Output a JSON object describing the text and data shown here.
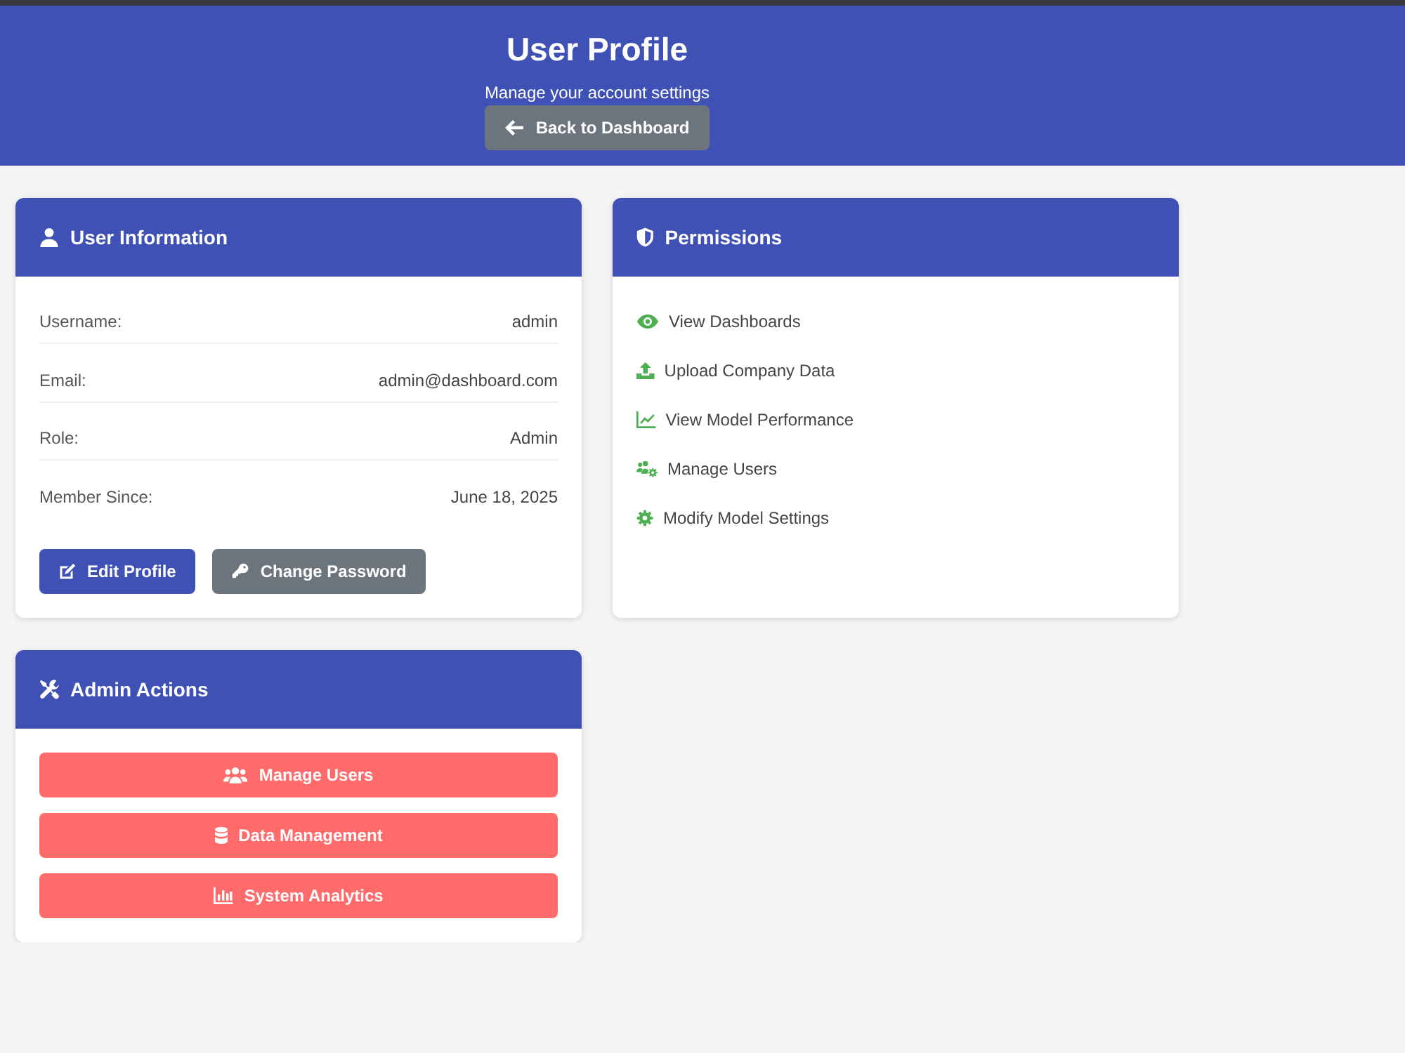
{
  "header": {
    "title": "User Profile",
    "subtitle": "Manage your account settings",
    "back_button": "Back to Dashboard"
  },
  "user_information": {
    "title": "User Information",
    "fields": [
      {
        "label": "Username:",
        "value": "admin"
      },
      {
        "label": "Email:",
        "value": "admin@dashboard.com"
      },
      {
        "label": "Role:",
        "value": "Admin"
      },
      {
        "label": "Member Since:",
        "value": "June 18, 2025"
      }
    ],
    "buttons": [
      {
        "label": "Edit Profile",
        "kind": "primary"
      },
      {
        "label": "Change Password",
        "kind": "secondary"
      }
    ]
  },
  "permissions": {
    "title": "Permissions",
    "items": [
      "View Dashboards",
      "Upload Company Data",
      "View Model Performance",
      "Manage Users",
      "Modify Model Settings"
    ]
  },
  "admin_actions": {
    "title": "Admin Actions",
    "buttons": [
      "Manage Users",
      "Data Management",
      "System Analytics"
    ]
  }
}
